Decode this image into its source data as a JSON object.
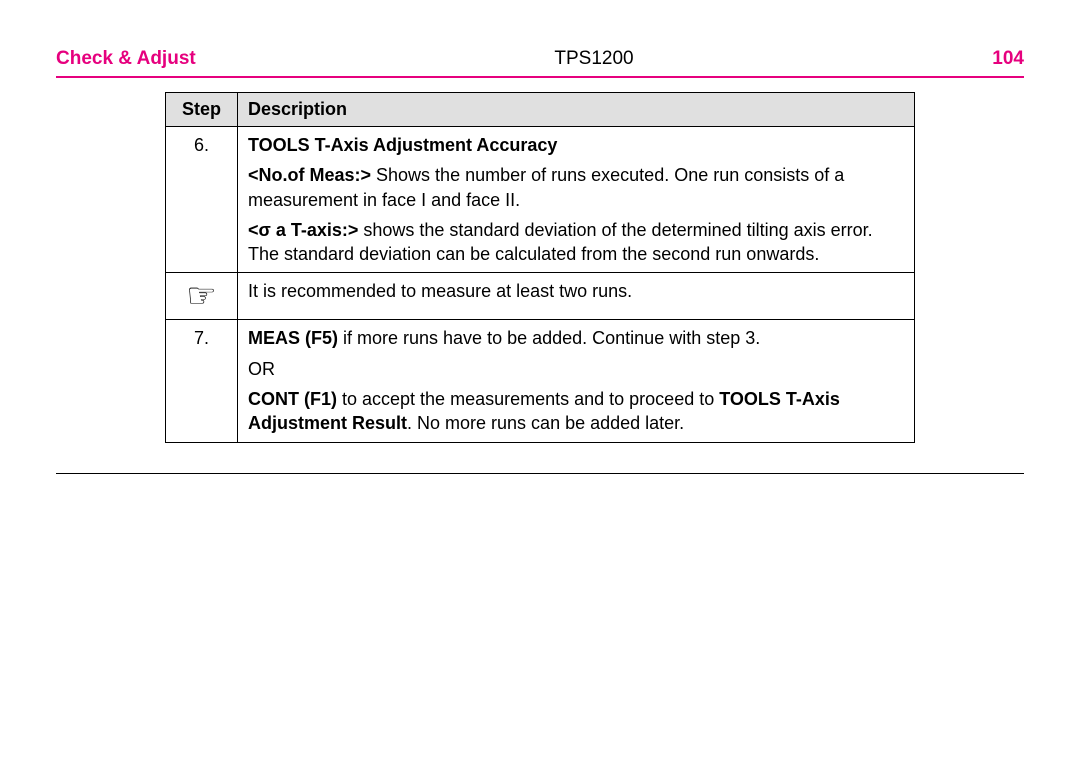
{
  "header": {
    "section": "Check & Adjust",
    "doc_title": "TPS1200",
    "page": "104"
  },
  "columns": {
    "step": "Step",
    "description": "Description"
  },
  "rows": {
    "r6": {
      "step": "6.",
      "title": "TOOLS T-Axis Adjustment Accuracy",
      "p1a": "<No.of Meas:>",
      "p1b": " Shows the number of runs executed. One run consists of a measurement in face I and face II.",
      "p2a": "<σ a T-axis:>",
      "p2b": " shows the standard deviation of the determined tilting axis error. The standard deviation can be calculated from the second run onwards."
    },
    "note": {
      "text": "It is recommended to measure at least two runs."
    },
    "r7": {
      "step": "7.",
      "p1a": "MEAS (F5)",
      "p1b": " if more runs have to be added. Continue with step 3.",
      "or": "OR",
      "p2a": "CONT (F1)",
      "p2b": " to accept the measurements and to proceed to ",
      "p2c": "TOOLS T-Axis Adjustment Result",
      "p2d": ". No more runs can be added later."
    }
  }
}
